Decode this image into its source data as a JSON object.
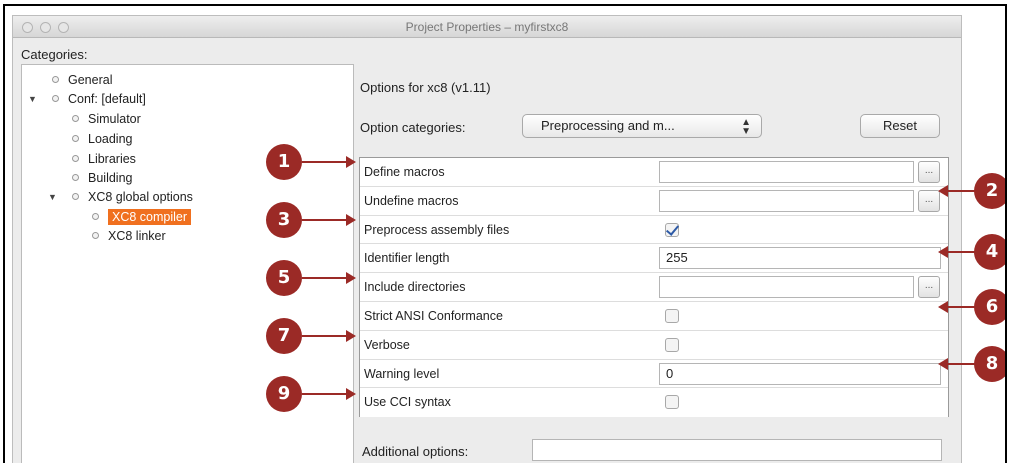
{
  "window": {
    "title": "Project Properties – myfirstxc8"
  },
  "categories": {
    "label": "Categories:",
    "items": [
      {
        "label": "General"
      },
      {
        "label": "Conf: [default]"
      },
      {
        "label": "Simulator"
      },
      {
        "label": "Loading"
      },
      {
        "label": "Libraries"
      },
      {
        "label": "Building"
      },
      {
        "label": "XC8 global options"
      },
      {
        "label": "XC8 compiler",
        "selected": true
      },
      {
        "label": "XC8 linker"
      }
    ]
  },
  "options": {
    "header": "Options for xc8 (v1.11)",
    "category_label": "Option categories:",
    "category_value": "Preprocessing and m...",
    "reset_label": "Reset",
    "rows": [
      {
        "label": "Define macros",
        "type": "text",
        "value": "",
        "has_browse": true
      },
      {
        "label": "Undefine macros",
        "type": "text",
        "value": "",
        "has_browse": true
      },
      {
        "label": "Preprocess assembly files",
        "type": "checkbox",
        "checked": true
      },
      {
        "label": "Identifier length",
        "type": "text",
        "value": "255",
        "has_browse": false
      },
      {
        "label": "Include directories",
        "type": "text",
        "value": "",
        "has_browse": true
      },
      {
        "label": "Strict ANSI Conformance",
        "type": "checkbox",
        "checked": false
      },
      {
        "label": "Verbose",
        "type": "checkbox",
        "checked": false
      },
      {
        "label": "Warning level",
        "type": "text",
        "value": "0",
        "has_browse": false
      },
      {
        "label": "Use CCI syntax",
        "type": "checkbox",
        "checked": false
      }
    ],
    "browse_label": "...",
    "additional_label": "Additional options:",
    "additional_value": ""
  },
  "callouts": [
    "1",
    "2",
    "3",
    "4",
    "5",
    "6",
    "7",
    "8",
    "9"
  ],
  "colors": {
    "callout": "#9b2a26",
    "selection": "#f0701f",
    "checkmark": "#2d5aa6"
  }
}
